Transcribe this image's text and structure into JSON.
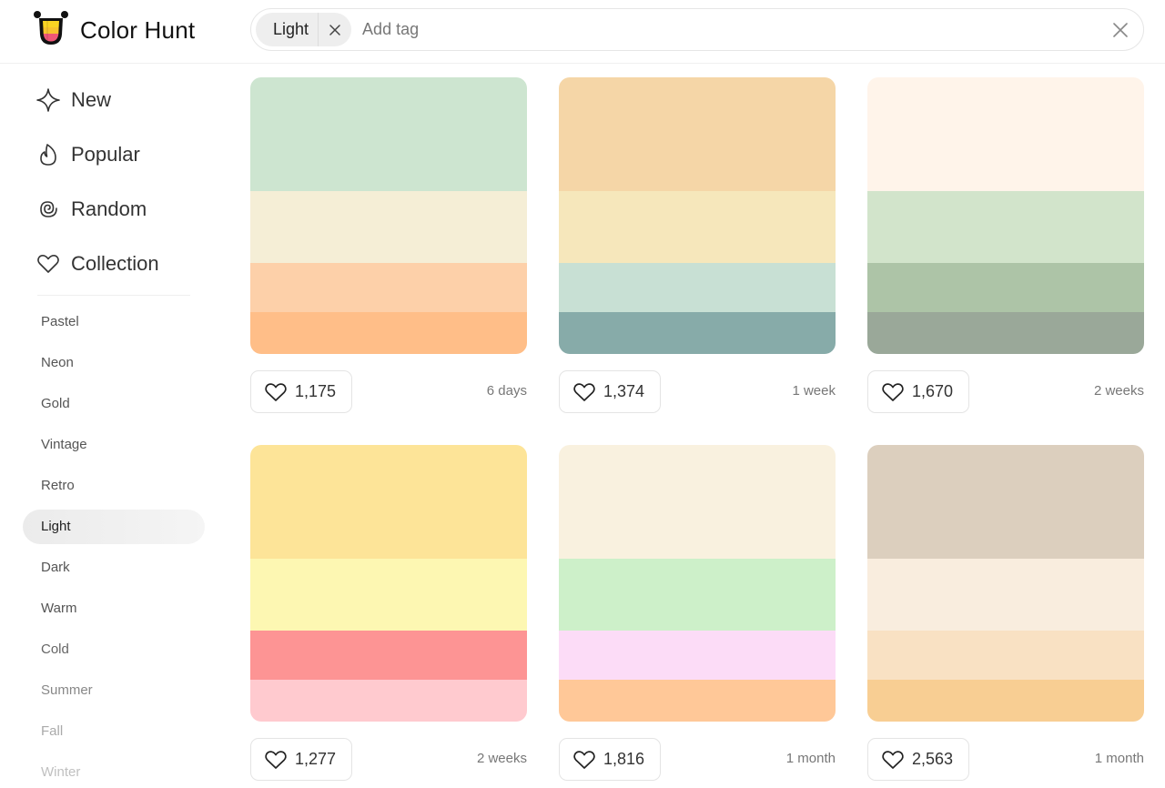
{
  "brand": {
    "name": "Color Hunt"
  },
  "search": {
    "active_tag": "Light",
    "placeholder": "Add tag"
  },
  "nav": {
    "main": [
      {
        "label": "New",
        "icon": "sparkle-icon"
      },
      {
        "label": "Popular",
        "icon": "flame-icon"
      },
      {
        "label": "Random",
        "icon": "spiral-icon"
      },
      {
        "label": "Collection",
        "icon": "heart-icon"
      }
    ],
    "tags": [
      {
        "label": "Pastel",
        "color": "#555555"
      },
      {
        "label": "Neon",
        "color": "#555555"
      },
      {
        "label": "Gold",
        "color": "#555555"
      },
      {
        "label": "Vintage",
        "color": "#555555"
      },
      {
        "label": "Retro",
        "color": "#555555"
      },
      {
        "label": "Light",
        "color": "#222222",
        "active": true
      },
      {
        "label": "Dark",
        "color": "#555555"
      },
      {
        "label": "Warm",
        "color": "#555555"
      },
      {
        "label": "Cold",
        "color": "#666666"
      },
      {
        "label": "Summer",
        "color": "#888888"
      },
      {
        "label": "Fall",
        "color": "#aaaaaa"
      },
      {
        "label": "Winter",
        "color": "#c0c0c0"
      }
    ]
  },
  "palettes": [
    {
      "colors": [
        "#CDE5D0",
        "#F5EED6",
        "#FDD0A9",
        "#FFBE88"
      ],
      "likes": "1,175",
      "date": "6 days"
    },
    {
      "colors": [
        "#F5D6A7",
        "#F6E7BB",
        "#C8E0D4",
        "#87ABA9"
      ],
      "likes": "1,374",
      "date": "1 week"
    },
    {
      "colors": [
        "#FFF4EA",
        "#D2E4CB",
        "#ADC4A7",
        "#9AA899"
      ],
      "likes": "1,670",
      "date": "2 weeks"
    },
    {
      "colors": [
        "#FDE498",
        "#FDF7B2",
        "#FD9494",
        "#FFCACF"
      ],
      "likes": "1,277",
      "date": "2 weeks"
    },
    {
      "colors": [
        "#F9F1DF",
        "#CDF0C9",
        "#FCDCF7",
        "#FFC898"
      ],
      "likes": "1,816",
      "date": "1 month"
    },
    {
      "colors": [
        "#DCCFBE",
        "#F9EDDE",
        "#F9E1C3",
        "#F8CE93"
      ],
      "likes": "2,563",
      "date": "1 month"
    }
  ]
}
